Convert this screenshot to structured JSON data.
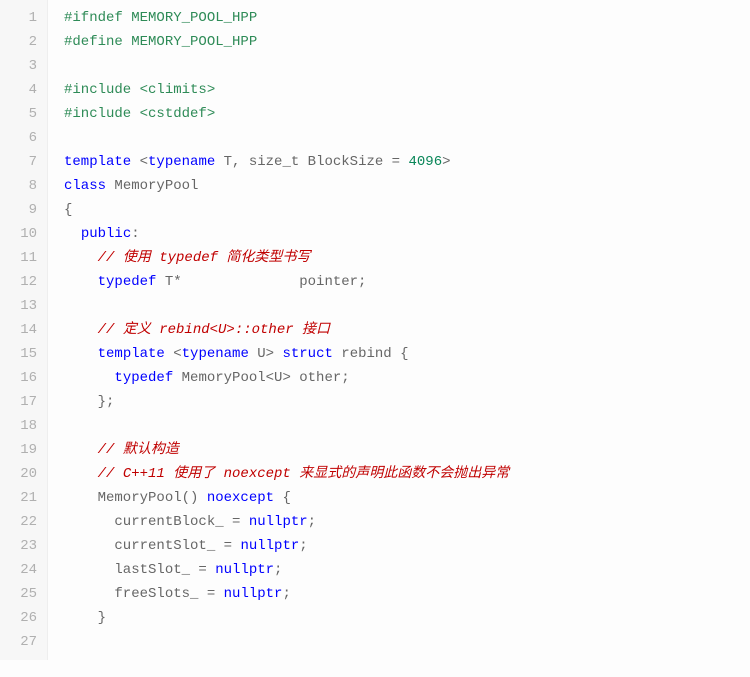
{
  "code": {
    "lines": [
      {
        "num": "1",
        "tokens": [
          {
            "cls": "tok-preproc",
            "t": "#ifndef MEMORY_POOL_HPP"
          }
        ]
      },
      {
        "num": "2",
        "tokens": [
          {
            "cls": "tok-preproc",
            "t": "#define MEMORY_POOL_HPP"
          }
        ]
      },
      {
        "num": "3",
        "tokens": []
      },
      {
        "num": "4",
        "tokens": [
          {
            "cls": "tok-preproc",
            "t": "#include <climits>"
          }
        ]
      },
      {
        "num": "5",
        "tokens": [
          {
            "cls": "tok-preproc",
            "t": "#include <cstddef>"
          }
        ]
      },
      {
        "num": "6",
        "tokens": []
      },
      {
        "num": "7",
        "tokens": [
          {
            "cls": "tok-keyword",
            "t": "template"
          },
          {
            "cls": "tok-punc",
            "t": " <"
          },
          {
            "cls": "tok-keyword",
            "t": "typename"
          },
          {
            "cls": "tok-ident",
            "t": " T, size_t BlockSize = "
          },
          {
            "cls": "tok-num",
            "t": "4096"
          },
          {
            "cls": "tok-punc",
            "t": ">"
          }
        ]
      },
      {
        "num": "8",
        "tokens": [
          {
            "cls": "tok-keyword",
            "t": "class"
          },
          {
            "cls": "tok-ident",
            "t": " MemoryPool"
          }
        ]
      },
      {
        "num": "9",
        "tokens": [
          {
            "cls": "tok-punc",
            "t": "{"
          }
        ]
      },
      {
        "num": "10",
        "tokens": [
          {
            "cls": "tok-ident",
            "t": "  "
          },
          {
            "cls": "tok-keyword",
            "t": "public"
          },
          {
            "cls": "tok-punc",
            "t": ":"
          }
        ]
      },
      {
        "num": "11",
        "tokens": [
          {
            "cls": "tok-ident",
            "t": "    "
          },
          {
            "cls": "tok-comment",
            "t": "// 使用 typedef 简化类型书写"
          }
        ]
      },
      {
        "num": "12",
        "tokens": [
          {
            "cls": "tok-ident",
            "t": "    "
          },
          {
            "cls": "tok-keyword",
            "t": "typedef"
          },
          {
            "cls": "tok-ident",
            "t": " T*              pointer;"
          }
        ]
      },
      {
        "num": "13",
        "tokens": []
      },
      {
        "num": "14",
        "tokens": [
          {
            "cls": "tok-ident",
            "t": "    "
          },
          {
            "cls": "tok-comment",
            "t": "// 定义 rebind<U>::other 接口"
          }
        ]
      },
      {
        "num": "15",
        "tokens": [
          {
            "cls": "tok-ident",
            "t": "    "
          },
          {
            "cls": "tok-keyword",
            "t": "template"
          },
          {
            "cls": "tok-punc",
            "t": " <"
          },
          {
            "cls": "tok-keyword",
            "t": "typename"
          },
          {
            "cls": "tok-ident",
            "t": " U> "
          },
          {
            "cls": "tok-keyword",
            "t": "struct"
          },
          {
            "cls": "tok-ident",
            "t": " rebind {"
          }
        ]
      },
      {
        "num": "16",
        "tokens": [
          {
            "cls": "tok-ident",
            "t": "      "
          },
          {
            "cls": "tok-keyword",
            "t": "typedef"
          },
          {
            "cls": "tok-ident",
            "t": " MemoryPool<U> other;"
          }
        ]
      },
      {
        "num": "17",
        "tokens": [
          {
            "cls": "tok-ident",
            "t": "    };"
          }
        ]
      },
      {
        "num": "18",
        "tokens": []
      },
      {
        "num": "19",
        "tokens": [
          {
            "cls": "tok-ident",
            "t": "    "
          },
          {
            "cls": "tok-comment",
            "t": "// 默认构造"
          }
        ]
      },
      {
        "num": "20",
        "tokens": [
          {
            "cls": "tok-ident",
            "t": "    "
          },
          {
            "cls": "tok-comment",
            "t": "// C++11 使用了 noexcept 来显式的声明此函数不会抛出异常"
          }
        ]
      },
      {
        "num": "21",
        "tokens": [
          {
            "cls": "tok-ident",
            "t": "    MemoryPool() "
          },
          {
            "cls": "tok-keyword",
            "t": "noexcept"
          },
          {
            "cls": "tok-ident",
            "t": " {"
          }
        ]
      },
      {
        "num": "22",
        "tokens": [
          {
            "cls": "tok-ident",
            "t": "      currentBlock_ = "
          },
          {
            "cls": "tok-keyword",
            "t": "nullptr"
          },
          {
            "cls": "tok-ident",
            "t": ";"
          }
        ]
      },
      {
        "num": "23",
        "tokens": [
          {
            "cls": "tok-ident",
            "t": "      currentSlot_ = "
          },
          {
            "cls": "tok-keyword",
            "t": "nullptr"
          },
          {
            "cls": "tok-ident",
            "t": ";"
          }
        ]
      },
      {
        "num": "24",
        "tokens": [
          {
            "cls": "tok-ident",
            "t": "      lastSlot_ = "
          },
          {
            "cls": "tok-keyword",
            "t": "nullptr"
          },
          {
            "cls": "tok-ident",
            "t": ";"
          }
        ]
      },
      {
        "num": "25",
        "tokens": [
          {
            "cls": "tok-ident",
            "t": "      freeSlots_ = "
          },
          {
            "cls": "tok-keyword",
            "t": "nullptr"
          },
          {
            "cls": "tok-ident",
            "t": ";"
          }
        ]
      },
      {
        "num": "26",
        "tokens": [
          {
            "cls": "tok-ident",
            "t": "    }"
          }
        ]
      },
      {
        "num": "27",
        "tokens": []
      }
    ]
  }
}
